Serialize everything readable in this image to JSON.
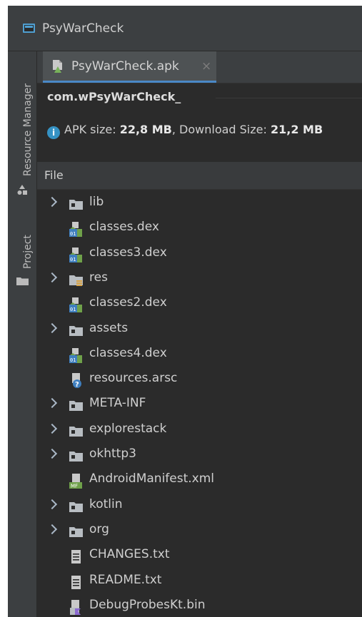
{
  "window": {
    "title": "PsyWarCheck"
  },
  "sidebar": {
    "tabs": [
      {
        "label": "Resource Manager"
      },
      {
        "label": "Project"
      }
    ]
  },
  "editor": {
    "tab": {
      "label": "PsyWarCheck.apk",
      "close": "×"
    }
  },
  "apk": {
    "package": "com.wPsyWarCheck_",
    "info_icon_text": "i",
    "apk_size_label": "APK size:",
    "apk_size_value": "22,8 MB",
    "separator": ", Download Size:",
    "download_size_value": "21,2 MB"
  },
  "table": {
    "header": "File",
    "rows": [
      {
        "name": "lib",
        "type": "folder",
        "expandable": true
      },
      {
        "name": "classes.dex",
        "type": "dex",
        "expandable": false
      },
      {
        "name": "classes3.dex",
        "type": "dex",
        "expandable": false
      },
      {
        "name": "res",
        "type": "res-folder",
        "expandable": true
      },
      {
        "name": "classes2.dex",
        "type": "dex",
        "expandable": false
      },
      {
        "name": "assets",
        "type": "folder",
        "expandable": true
      },
      {
        "name": "classes4.dex",
        "type": "dex",
        "expandable": false
      },
      {
        "name": "resources.arsc",
        "type": "arsc",
        "expandable": false
      },
      {
        "name": "META-INF",
        "type": "folder",
        "expandable": true
      },
      {
        "name": "explorestack",
        "type": "folder",
        "expandable": true
      },
      {
        "name": "okhttp3",
        "type": "folder",
        "expandable": true
      },
      {
        "name": "AndroidManifest.xml",
        "type": "manifest",
        "expandable": false
      },
      {
        "name": "kotlin",
        "type": "folder",
        "expandable": true
      },
      {
        "name": "org",
        "type": "folder",
        "expandable": true
      },
      {
        "name": "CHANGES.txt",
        "type": "text",
        "expandable": false
      },
      {
        "name": "README.txt",
        "type": "text",
        "expandable": false
      },
      {
        "name": "DebugProbesKt.bin",
        "type": "bin",
        "expandable": false
      }
    ]
  },
  "colors": {
    "background": "#2b2b2b",
    "panel": "#3c3f41",
    "accent": "#4a88c7",
    "folder": "#b8bdc2",
    "dex_green": "#6fa14a",
    "dex_blue": "#3f7fbf"
  }
}
